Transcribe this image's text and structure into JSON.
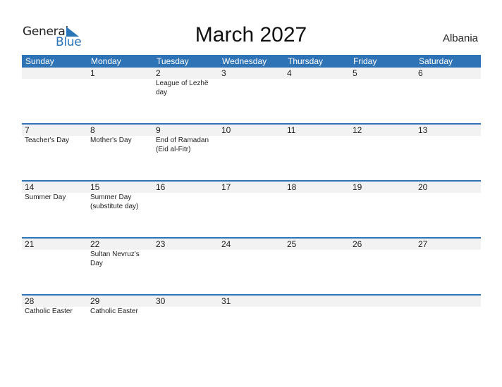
{
  "logo": {
    "general": "General",
    "blue": "Blue"
  },
  "title": "March 2027",
  "country": "Albania",
  "weekdays": [
    "Sunday",
    "Monday",
    "Tuesday",
    "Wednesday",
    "Thursday",
    "Friday",
    "Saturday"
  ],
  "weeks": [
    [
      {
        "day": "",
        "event": ""
      },
      {
        "day": "1",
        "event": ""
      },
      {
        "day": "2",
        "event": "League of Lezhë day"
      },
      {
        "day": "3",
        "event": ""
      },
      {
        "day": "4",
        "event": ""
      },
      {
        "day": "5",
        "event": ""
      },
      {
        "day": "6",
        "event": ""
      }
    ],
    [
      {
        "day": "7",
        "event": "Teacher's Day"
      },
      {
        "day": "8",
        "event": "Mother's Day"
      },
      {
        "day": "9",
        "event": "End of Ramadan (Eid al-Fitr)"
      },
      {
        "day": "10",
        "event": ""
      },
      {
        "day": "11",
        "event": ""
      },
      {
        "day": "12",
        "event": ""
      },
      {
        "day": "13",
        "event": ""
      }
    ],
    [
      {
        "day": "14",
        "event": "Summer Day"
      },
      {
        "day": "15",
        "event": "Summer Day (substitute day)"
      },
      {
        "day": "16",
        "event": ""
      },
      {
        "day": "17",
        "event": ""
      },
      {
        "day": "18",
        "event": ""
      },
      {
        "day": "19",
        "event": ""
      },
      {
        "day": "20",
        "event": ""
      }
    ],
    [
      {
        "day": "21",
        "event": ""
      },
      {
        "day": "22",
        "event": "Sultan Nevruz's Day"
      },
      {
        "day": "23",
        "event": ""
      },
      {
        "day": "24",
        "event": ""
      },
      {
        "day": "25",
        "event": ""
      },
      {
        "day": "26",
        "event": ""
      },
      {
        "day": "27",
        "event": ""
      }
    ],
    [
      {
        "day": "28",
        "event": "Catholic Easter"
      },
      {
        "day": "29",
        "event": "Catholic Easter"
      },
      {
        "day": "30",
        "event": ""
      },
      {
        "day": "31",
        "event": ""
      },
      {
        "day": "",
        "event": ""
      },
      {
        "day": "",
        "event": ""
      },
      {
        "day": "",
        "event": ""
      }
    ]
  ]
}
